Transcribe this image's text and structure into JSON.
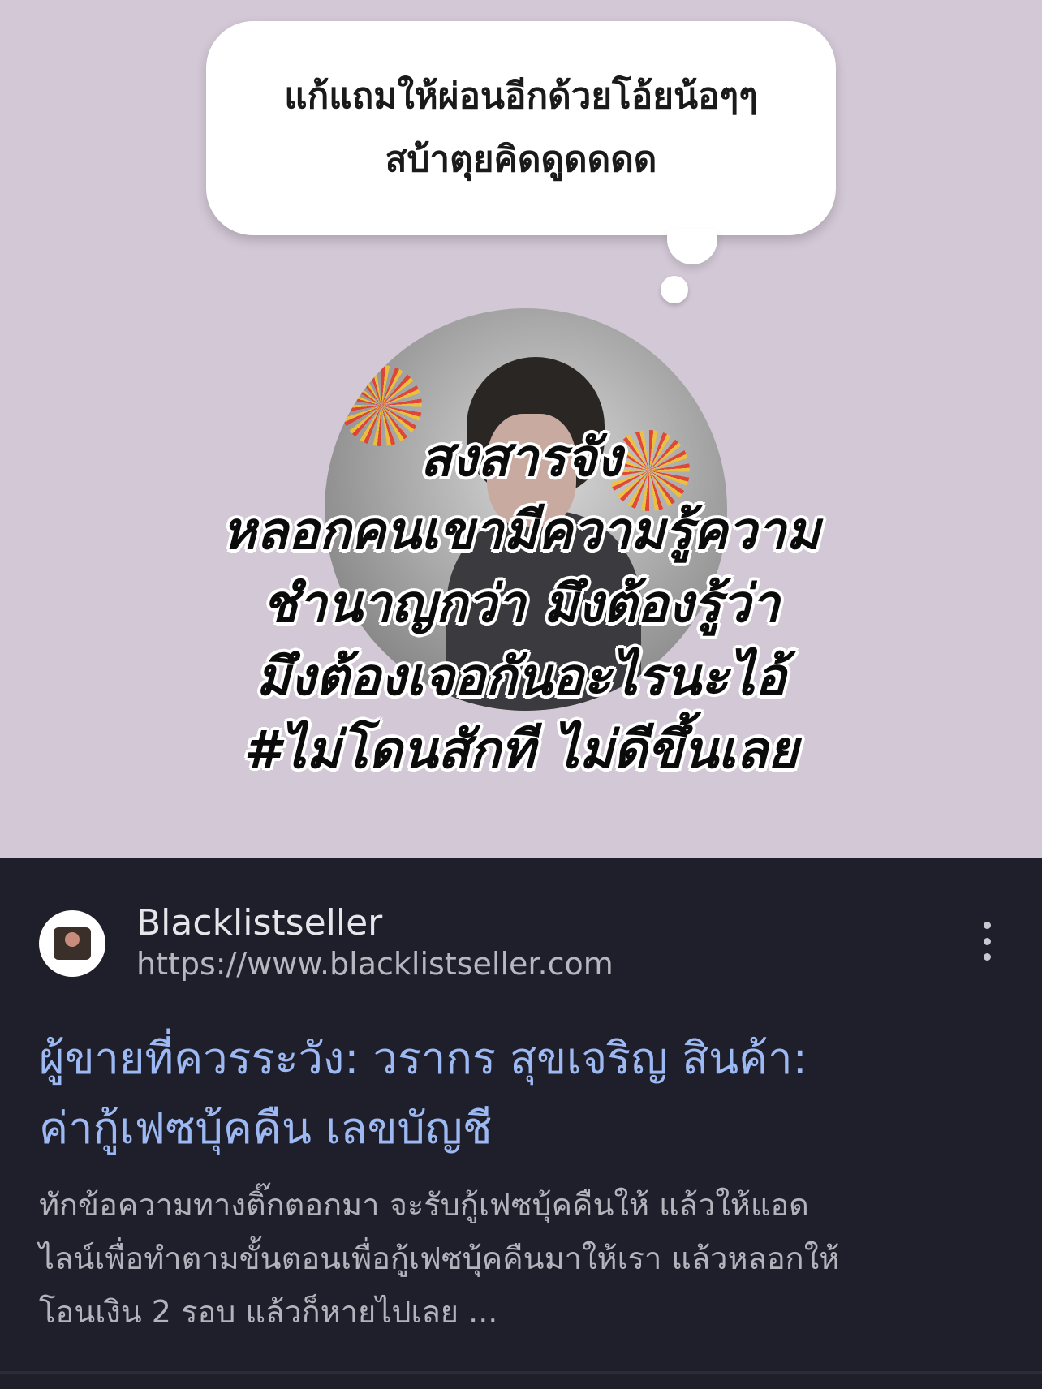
{
  "meme": {
    "bubble": {
      "line1": "แก้แถมให้ผ่อนอีกด้วยโอ้ยน้อๆๆ",
      "line2": "สบ้าตุยคิดดูดดดด"
    },
    "caption": [
      "สงสารจัง",
      "หลอกคนเขามีความรู้ความ",
      "ชำนาญกว่า มึงต้องรู้ว่า",
      "มึงต้องเจอกันอะไรนะไอ้",
      "#ไม่โดนสักที ไม่ดีขึ้นเลย"
    ]
  },
  "result": {
    "site_name": "Blacklistseller",
    "site_url": "https://www.blacklistseller.com",
    "title": [
      "ผู้ขายที่ควรระวัง: วรากร สุขเจริญ สินค้า:",
      "ค่ากู้เฟซบุ้คคืน เลขบัญชี"
    ],
    "snippet": [
      "ทักข้อความทางติ๊กตอกมา จะรับกู้เฟซบุ้คคืนให้ แล้วให้แอด",
      "ไลน์เพื่อทำตามขั้นตอนเพื่อกู้เฟซบุ้คคืนมาให้เรา แล้วหลอกให้",
      "โอนเงิน 2 รอบ แล้วก็หายไปเลย ..."
    ],
    "icons": {
      "site_favicon": "site-avatar-icon",
      "menu": "more-vertical-icon"
    },
    "colors": {
      "title": "#9cb9f4",
      "background": "#1f1f2b",
      "meme_background": "#d3c8d6"
    }
  }
}
